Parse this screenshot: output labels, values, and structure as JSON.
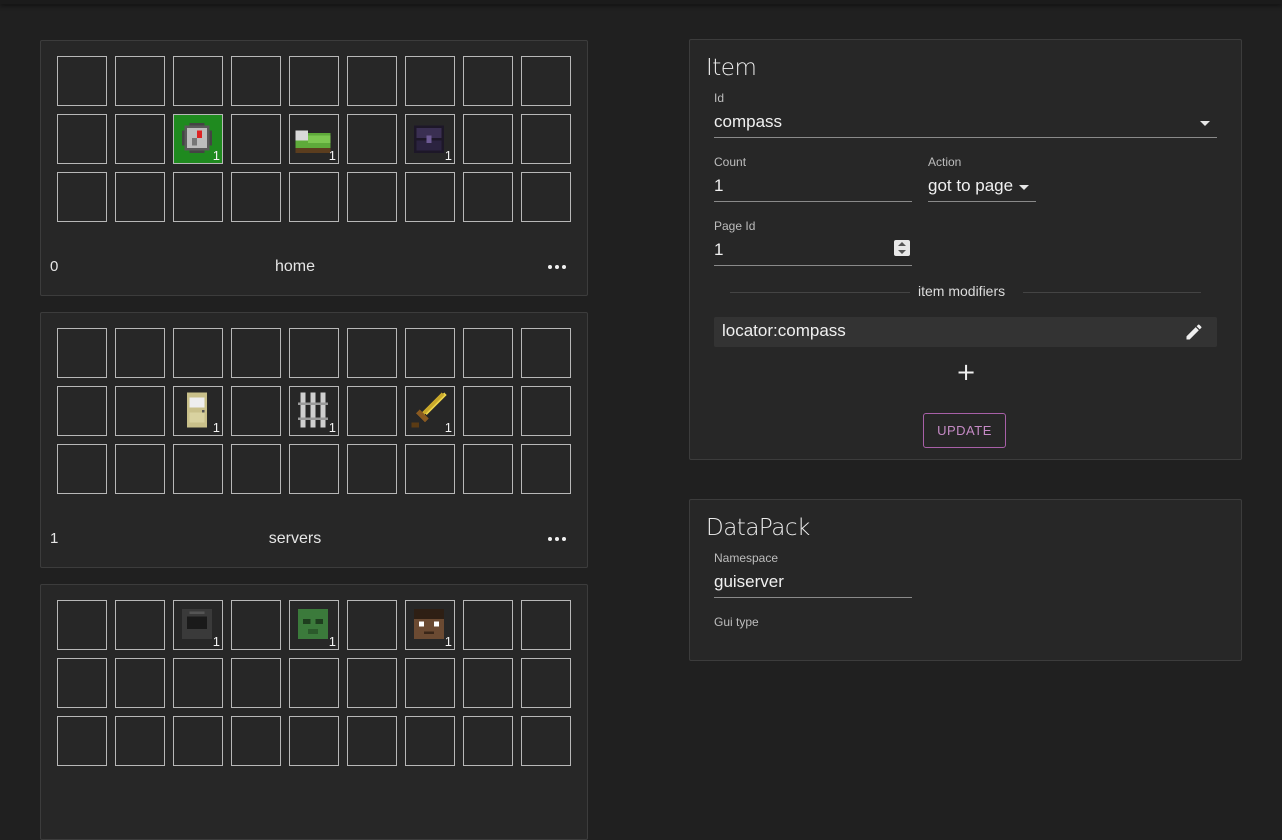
{
  "pages": [
    {
      "index": "0",
      "name": "home",
      "items": [
        {
          "slot": 11,
          "icon": "compass-icon",
          "count": "1",
          "selected": true
        },
        {
          "slot": 13,
          "icon": "green-bed-icon",
          "count": "1"
        },
        {
          "slot": 15,
          "icon": "ender-chest-icon",
          "count": "1"
        }
      ]
    },
    {
      "index": "1",
      "name": "servers",
      "items": [
        {
          "slot": 11,
          "icon": "door-icon",
          "count": "1"
        },
        {
          "slot": 13,
          "icon": "iron-bars-icon",
          "count": "1"
        },
        {
          "slot": 15,
          "icon": "golden-sword-icon",
          "count": "1"
        }
      ]
    },
    {
      "index": "",
      "name": "",
      "items": [
        {
          "slot": 2,
          "icon": "furnace-icon",
          "count": "1"
        },
        {
          "slot": 4,
          "icon": "zombie-head-icon",
          "count": "1"
        },
        {
          "slot": 6,
          "icon": "steve-head-icon",
          "count": "1"
        }
      ]
    }
  ],
  "item_panel": {
    "title": "Item",
    "id_label": "Id",
    "id_value": "compass",
    "count_label": "Count",
    "count_value": "1",
    "action_label": "Action",
    "action_value": "got to page",
    "page_id_label": "Page Id",
    "page_id_value": "1",
    "modifiers_heading": "item modifiers",
    "modifiers": [
      "locator:compass"
    ],
    "add_label": "+",
    "update_label": "UPDATE"
  },
  "datapack_panel": {
    "title": "DataPack",
    "namespace_label": "Namespace",
    "namespace_value": "guiserver",
    "gui_type_label": "Gui type"
  },
  "colors": {
    "background": "#202020",
    "card": "#272727",
    "selected_slot": "#1f8a1f",
    "accent": "#a860a8"
  }
}
